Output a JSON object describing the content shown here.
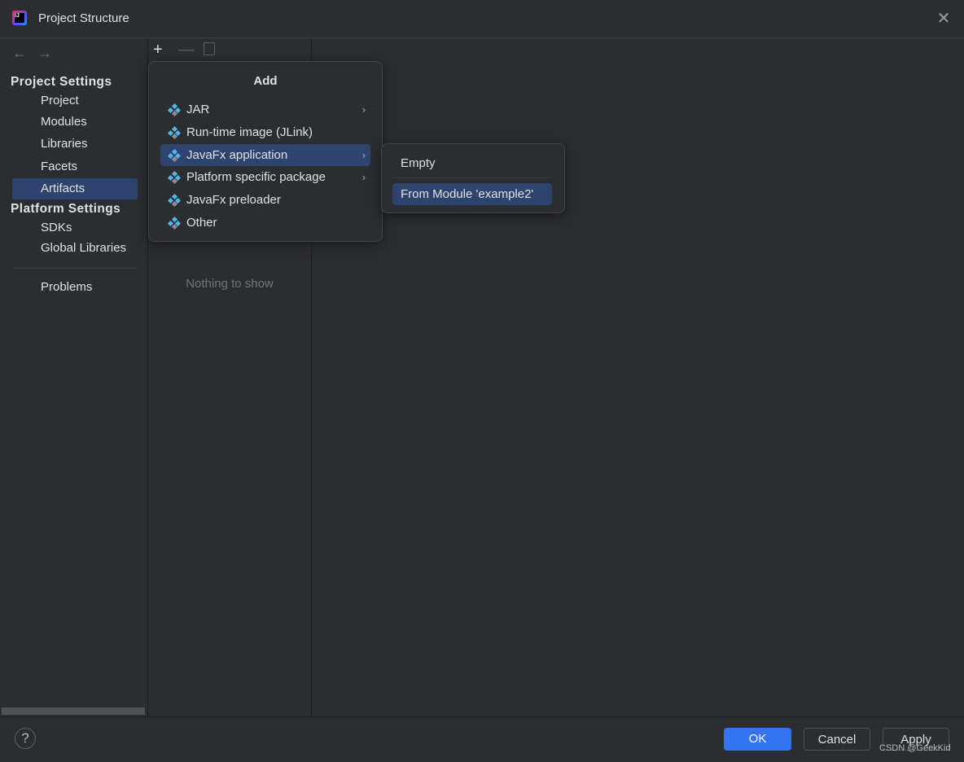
{
  "window": {
    "title": "Project Structure",
    "app_icon": "intellij-idea-icon",
    "close_icon": "close-icon"
  },
  "nav": {
    "back_icon": "arrow-left-icon",
    "forward_icon": "arrow-right-icon"
  },
  "sidebar": {
    "sections": [
      {
        "label": "Project Settings",
        "items": [
          {
            "label": "Project"
          },
          {
            "label": "Modules"
          },
          {
            "label": "Libraries"
          },
          {
            "label": "Facets"
          },
          {
            "label": "Artifacts",
            "selected": true
          }
        ]
      },
      {
        "label": "Platform Settings",
        "items": [
          {
            "label": "SDKs"
          },
          {
            "label": "Global Libraries"
          }
        ]
      }
    ],
    "problems": "Problems"
  },
  "toolbar": {
    "add": "+",
    "remove": "—",
    "copy_icon": "copy-icon"
  },
  "list": {
    "empty_text": "Nothing to show"
  },
  "add_menu": {
    "title": "Add",
    "items": [
      {
        "label": "JAR",
        "submenu": true
      },
      {
        "label": "Run-time image (JLink)",
        "submenu": false
      },
      {
        "label": "JavaFx application",
        "submenu": true,
        "selected": true
      },
      {
        "label": "Platform specific package",
        "submenu": true
      },
      {
        "label": "JavaFx preloader",
        "submenu": false
      },
      {
        "label": "Other",
        "submenu": false
      }
    ],
    "chevron": "›"
  },
  "submenu": {
    "items": [
      {
        "label": "Empty"
      },
      {
        "label": "From Module 'example2'",
        "selected": true
      }
    ]
  },
  "footer": {
    "help": "?",
    "ok": "OK",
    "cancel": "Cancel",
    "apply": "Apply",
    "watermark": "CSDN @GeekKid"
  },
  "colors": {
    "accent": "#3574f0",
    "selection": "#2e436e",
    "background": "#2b2d30",
    "artifact_icon_blue": "#4fb7e8",
    "artifact_icon_gray": "#8c8f94"
  }
}
